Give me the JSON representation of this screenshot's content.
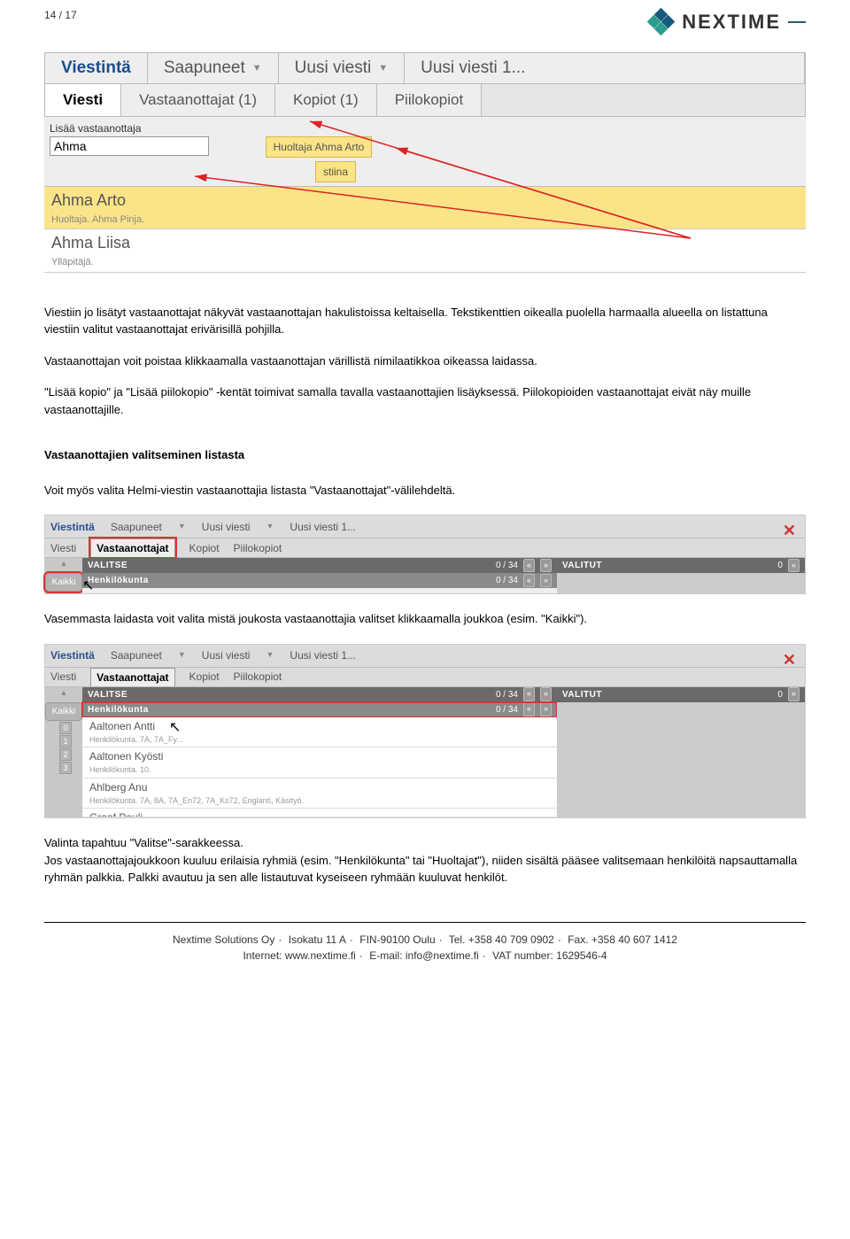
{
  "page_indicator": "14 / 17",
  "brand": "NEXTIME",
  "ui1": {
    "main_tabs": {
      "viestinta": "Viestintä",
      "saapuneet": "Saapuneet",
      "uusi_viesti": "Uusi viesti",
      "uusi_viesti1": "Uusi viesti 1..."
    },
    "sub_tabs": {
      "viesti": "Viesti",
      "vastaanottajat": "Vastaanottajat (1)",
      "kopiot": "Kopiot (1)",
      "piilokopiot": "Piilokopiot"
    },
    "input_label": "Lisää vastaanottaja",
    "input_value": "Ahma",
    "chip_text": "Huoltaja Ahma Arto",
    "chip_text2": "stiina",
    "dropdown": [
      {
        "name": "Ahma Arto",
        "meta": "Huoltaja. Ahma Pinja."
      },
      {
        "name": "Ahma Liisa",
        "meta": "Ylläpitäjä."
      }
    ]
  },
  "body": {
    "p1": "Viestiin jo lisätyt vastaanottajat näkyvät vastaanottajan hakulistoissa keltaisella. Tekstikenttien oikealla puolella harmaalla alueella on listattuna viestiin valitut vastaanottajat erivärisillä pohjilla.",
    "p2": "Vastaanottajan voit poistaa klikkaamalla vastaanottajan värillistä nimilaatikkoa oikeassa laidassa.",
    "p3": "\"Lisää kopio\" ja \"Lisää piilokopio\" -kentät toimivat samalla tavalla vastaanottajien lisäyksessä. Piilokopioiden vastaanottajat eivät näy muille vastaanottajille.",
    "h1": "Vastaanottajien valitseminen listasta",
    "p4": "Voit myös valita Helmi-viestin vastaanottajia listasta \"Vastaanottajat\"-välilehdeltä.",
    "p5": "Vasemmasta laidasta voit valita mistä joukosta vastaanottajia valitset klikkaamalla joukkoa (esim. \"Kaikki\").",
    "p6a": "Valinta tapahtuu \"Valitse\"-sarakkeessa.",
    "p6b": "Jos vastaanottajajoukkoon kuuluu erilaisia ryhmiä (esim. \"Henkilökunta\" tai \"Huoltajat\"), niiden sisältä pääsee valitsemaan henkilöitä napsauttamalla ryhmän palkkia. Palkki avautuu ja sen alle listautuvat kyseiseen ryhmään kuuluvat henkilöt."
  },
  "ui2": {
    "main": {
      "viestinta": "Viestintä",
      "saapuneet": "Saapuneet",
      "uusi": "Uusi viesti",
      "uusi1": "Uusi viesti 1..."
    },
    "sub": {
      "viesti": "Viesti",
      "vast": "Vastaanottajat",
      "kopiot": "Kopiot",
      "piilo": "Piilokopiot"
    },
    "kaikki": "Kaikki",
    "valitse": "VALITSE",
    "valitut": "VALITUT",
    "henk": "Henkilökunta",
    "c034": "0 / 34",
    "c0": "0"
  },
  "ui3": {
    "rows": [
      {
        "name": "Aaltonen Antti",
        "meta": "Henkilökunta. 7A, 7A_Fy..."
      },
      {
        "name": "Aaltonen Kyösti",
        "meta": "Henkilökunta. 10."
      },
      {
        "name": "Ahlberg Anu",
        "meta": "Henkilökunta. 7A, 8A, 7A_En72, 7A_Ks72, Englanti, Käsityö."
      },
      {
        "name": "Graaf Pauli",
        "meta": ""
      }
    ],
    "nums": [
      "0",
      "1",
      "2",
      "3"
    ]
  },
  "footer": {
    "line1_parts": [
      "Nextime Solutions Oy",
      "Isokatu 11 A",
      "FIN-90100 Oulu",
      "Tel. +358 40 709 0902",
      "Fax. +358 40 607 1412"
    ],
    "line2_parts": [
      "Internet: www.nextime.fi",
      "E-mail: info@nextime.fi",
      "VAT number: 1629546-4"
    ]
  }
}
